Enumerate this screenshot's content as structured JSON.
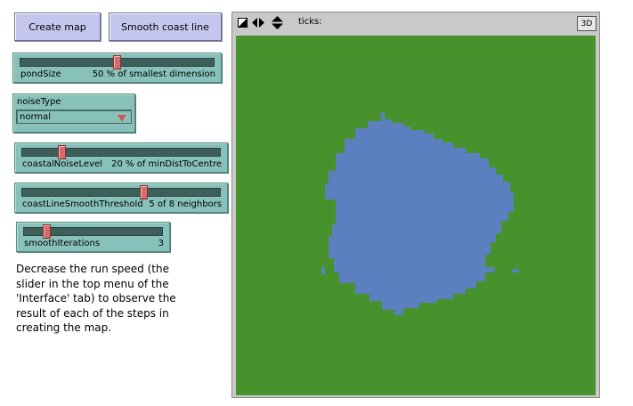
{
  "buttons": {
    "create_map": "Create map",
    "smooth_coast": "Smooth coast line"
  },
  "sliders": [
    {
      "name": "pondSize",
      "value_text": "50 % of smallest dimension",
      "fraction": 0.5
    },
    {
      "name": "coastalNoiseLevel",
      "value_text": "20 % of minDistToCentre",
      "fraction": 0.19
    },
    {
      "name": "coastLineSmoothThreshold",
      "value_text": "5 of 8 neighbors",
      "fraction": 0.62
    },
    {
      "name": "smoothIterations",
      "value_text": "3",
      "fraction": 0.15
    }
  ],
  "chooser": {
    "label": "noiseType",
    "value": "normal"
  },
  "note": "Decrease the run speed (the slider in the top menu of the 'Interface' tab) to observe the result of each of the steps in creating the map.",
  "view": {
    "ticks_label": "ticks:",
    "btn_3d": "3D",
    "land_color": "#47922d",
    "water_color": "#5b7fbf"
  }
}
